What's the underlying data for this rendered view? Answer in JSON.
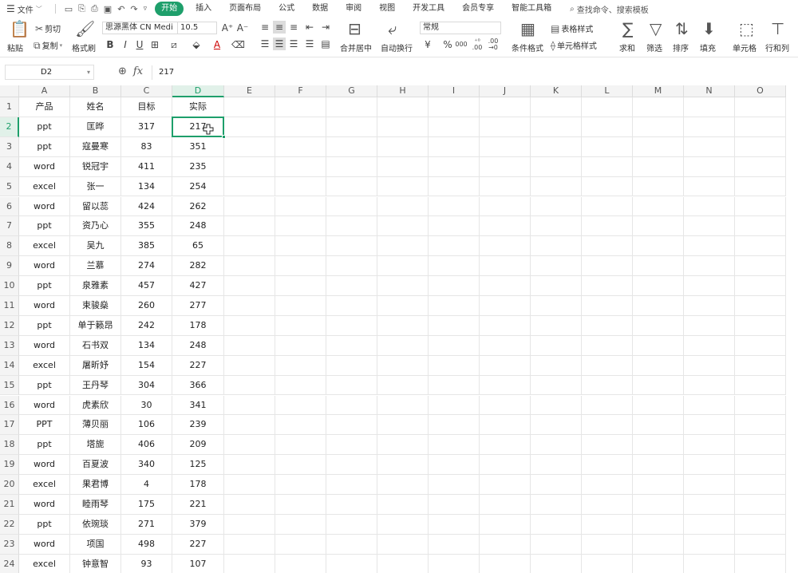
{
  "menubar": {
    "file_label": "文件",
    "tabs": [
      "开始",
      "插入",
      "页面布局",
      "公式",
      "数据",
      "审阅",
      "视图",
      "开发工具",
      "会员专享",
      "智能工具箱"
    ],
    "active_tab": "开始",
    "search_label": "查找命令、搜索模板"
  },
  "ribbon": {
    "cut": "剪切",
    "copy": "复制",
    "paste": "粘贴",
    "format_painter": "格式刷",
    "font_name": "思源黑体 CN Medi",
    "font_size": "10.5",
    "merge_center": "合并居中",
    "wrap_text": "自动换行",
    "number_format": "常规",
    "currency_symbol": "¥",
    "percent_symbol": "%",
    "thousands_symbol": "000",
    "increase_decimal": "+0\n.00",
    "decrease_decimal": ".00\n→0",
    "conditional_format": "条件格式",
    "table_style": "表格样式",
    "cell_style": "单元格样式",
    "sum": "求和",
    "filter": "筛选",
    "sort": "排序",
    "fill": "填充",
    "cell": "单元格",
    "row_col": "行和列"
  },
  "formula_bar": {
    "name_box": "D2",
    "fx_label": "fx",
    "content": "217"
  },
  "sheet": {
    "columns": [
      "A",
      "B",
      "C",
      "D",
      "E",
      "F",
      "G",
      "H",
      "I",
      "J",
      "K",
      "L",
      "M",
      "N",
      "O"
    ],
    "selected_column": "D",
    "selected_row": 2,
    "rows": [
      [
        "产品",
        "姓名",
        "目标",
        "实际"
      ],
      [
        "ppt",
        "匡晔",
        "317",
        "217"
      ],
      [
        "ppt",
        "寇曼寒",
        "83",
        "351"
      ],
      [
        "word",
        "锐冠宇",
        "411",
        "235"
      ],
      [
        "excel",
        "张一",
        "134",
        "254"
      ],
      [
        "word",
        "留以蕊",
        "424",
        "262"
      ],
      [
        "ppt",
        "资乃心",
        "355",
        "248"
      ],
      [
        "excel",
        "吴九",
        "385",
        "65"
      ],
      [
        "word",
        "兰慕",
        "274",
        "282"
      ],
      [
        "ppt",
        "泉雅素",
        "457",
        "427"
      ],
      [
        "word",
        "束骏燊",
        "260",
        "277"
      ],
      [
        "ppt",
        "单于籁昂",
        "242",
        "178"
      ],
      [
        "word",
        "石书双",
        "134",
        "248"
      ],
      [
        "excel",
        "屠昕妤",
        "154",
        "227"
      ],
      [
        "ppt",
        "王丹琴",
        "304",
        "366"
      ],
      [
        "word",
        "虎素欣",
        "30",
        "341"
      ],
      [
        "PPT",
        "薄贝丽",
        "106",
        "239"
      ],
      [
        "ppt",
        "塔旎",
        "406",
        "209"
      ],
      [
        "word",
        "百夏波",
        "340",
        "125"
      ],
      [
        "excel",
        "果君博",
        "4",
        "178"
      ],
      [
        "word",
        "睦雨琴",
        "175",
        "221"
      ],
      [
        "ppt",
        "依琬琰",
        "271",
        "379"
      ],
      [
        "word",
        "项国",
        "498",
        "227"
      ],
      [
        "excel",
        "钟意智",
        "93",
        "107"
      ]
    ]
  },
  "colors": {
    "accent": "#1e9f6b",
    "header_bg": "#f4f4f4",
    "selected_header_bg": "#e1f1e9",
    "grid_line": "#e6e6e6"
  }
}
